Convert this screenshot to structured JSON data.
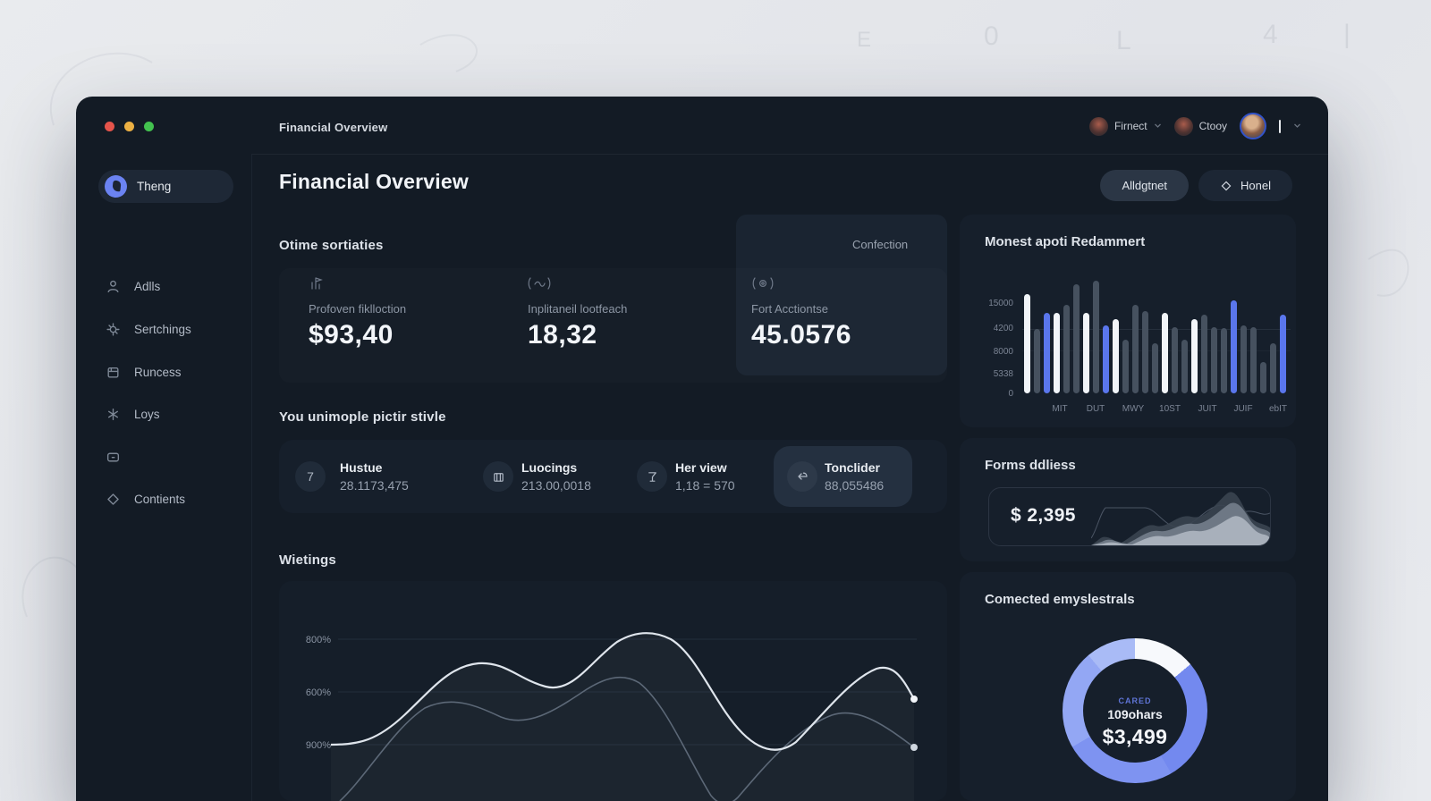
{
  "topbar": {
    "title": "Financial Overview",
    "account_primary": "Firnect",
    "account_secondary": "Ctooy"
  },
  "sidebar": {
    "items": [
      {
        "label": "Theng"
      },
      {
        "label": "Adlls"
      },
      {
        "label": "Sertchings"
      },
      {
        "label": "Runcess"
      },
      {
        "label": "Loys"
      },
      {
        "label": ""
      },
      {
        "label": "Contients"
      }
    ]
  },
  "header": {
    "title": "Financial Overview",
    "secondary_button": "Alldgtnet",
    "primary_button": "Honel"
  },
  "stats": {
    "heading": "Otime sortiaties",
    "action": "Confection",
    "cards": [
      {
        "icon": "bar-flag-icon",
        "label": "Profoven fiklloction",
        "value": "$93,40"
      },
      {
        "icon": "squiggle-icon",
        "label": "Inplitaneil lootfeach",
        "value": "18,32"
      },
      {
        "icon": "at-icon",
        "label": "Fort Acctiontse",
        "value": "45.0576"
      }
    ]
  },
  "metrics": {
    "heading": "You unimople pictir stivle",
    "items": [
      {
        "icon": "7",
        "label": "Hustue",
        "value": "28.1173,475"
      },
      {
        "icon": "bank-icon",
        "label": "Luocings",
        "value": "213.00,0018"
      },
      {
        "icon": "martini-icon",
        "label": "Her view",
        "value": "1,18 = 570"
      },
      {
        "icon": "return-arrow-icon",
        "label": "Tonclider",
        "value": "88,055486",
        "highlighted": true
      }
    ]
  },
  "line_section": {
    "heading": "Wietings"
  },
  "bar_card": {
    "title": "Monest apoti Redammert"
  },
  "forms_card": {
    "title": "Forms ddliess",
    "value": "$ 2,395"
  },
  "donut_card": {
    "title": "Comected emyslestrals",
    "center_tag": "CARED",
    "center_label": "109ohars",
    "center_value": "$3,499"
  },
  "colors": {
    "accent_blue": "#5a76ec",
    "bar_white": "#f2f5f9",
    "bar_gray": "#46515f",
    "donut_white": "#f7f9fc",
    "donut_deep": "#7389ef",
    "donut_light": "#a9bbf6",
    "traffic_red": "#e5544b",
    "traffic_yellow": "#ecb043",
    "traffic_green": "#43c24f"
  },
  "chart_data": [
    {
      "type": "bar",
      "title": "Monest apoti Redammert",
      "y_ticks": [
        "15000",
        "4200",
        "8000",
        "5338",
        "0"
      ],
      "x_ticks": [
        "MIT",
        "DUT",
        "MWY",
        "10ST",
        "JUIT",
        "JUIF",
        "ebIT"
      ],
      "ylim": [
        0,
        16000
      ],
      "grid": "horizontal line at 4200 tick",
      "legend": false,
      "values": [
        12700,
        8200,
        10300,
        10300,
        11300,
        13900,
        10300,
        14400,
        8700,
        9500,
        6900,
        11300,
        10500,
        6400,
        10300,
        8500,
        6900,
        9500,
        10000,
        8400,
        8300,
        11900,
        8700,
        8400,
        4000,
        6400,
        10000
      ],
      "bar_colors": [
        "white",
        "gray",
        "blue",
        "white",
        "gray",
        "gray",
        "white",
        "gray",
        "blue",
        "white",
        "gray",
        "gray",
        "gray",
        "gray",
        "white",
        "gray",
        "gray",
        "white",
        "gray",
        "gray",
        "gray",
        "blue",
        "gray",
        "gray",
        "gray",
        "gray",
        "blue"
      ]
    },
    {
      "type": "line",
      "title": "Wietings",
      "y_ticks": [
        "800%",
        "600%",
        "900%"
      ],
      "grid": "3 horizontal gridlines",
      "legend": false,
      "series": [
        {
          "name": "primary-white",
          "points_xy_fraction": [
            [
              0.08,
              0.74
            ],
            [
              0.19,
              0.61
            ],
            [
              0.3,
              0.37
            ],
            [
              0.4,
              0.48
            ],
            [
              0.51,
              0.28
            ],
            [
              0.59,
              0.22
            ],
            [
              0.69,
              0.69
            ],
            [
              0.77,
              0.79
            ],
            [
              0.89,
              0.4
            ],
            [
              0.95,
              0.53
            ]
          ]
        },
        {
          "name": "secondary-gray",
          "points_xy_fraction": [
            [
              0.09,
              1.0
            ],
            [
              0.22,
              0.58
            ],
            [
              0.33,
              0.62
            ],
            [
              0.45,
              0.46
            ],
            [
              0.56,
              0.31
            ],
            [
              0.64,
              0.96
            ],
            [
              0.72,
              1.0
            ],
            [
              0.83,
              0.61
            ],
            [
              0.95,
              0.76
            ]
          ]
        }
      ]
    },
    {
      "type": "pie",
      "title": "Comected emyslestrals",
      "shape": "donut",
      "slices": [
        {
          "label": "white-segment",
          "value": 14
        },
        {
          "label": "blue-segment",
          "value": 86
        }
      ],
      "center_text": {
        "tag": "CARED",
        "label": "109ohars",
        "value": "$3,499"
      }
    },
    {
      "type": "area",
      "title": "Forms ddliess sparkline",
      "value_label": "$ 2,395",
      "layers": [
        {
          "name": "back-dark",
          "values": [
            0.1,
            0.2,
            0.15,
            0.3,
            0.5,
            0.45,
            0.6,
            0.95,
            0.7,
            0.3,
            0.25
          ]
        },
        {
          "name": "mid-gray",
          "values": [
            0.05,
            0.25,
            0.1,
            0.25,
            0.4,
            0.35,
            0.5,
            0.8,
            0.55,
            0.35,
            0.2
          ]
        },
        {
          "name": "front-light",
          "values": [
            0.05,
            0.3,
            0.12,
            0.28,
            0.35,
            0.42,
            0.38,
            0.65,
            0.45,
            0.3,
            0.15
          ]
        }
      ]
    }
  ]
}
